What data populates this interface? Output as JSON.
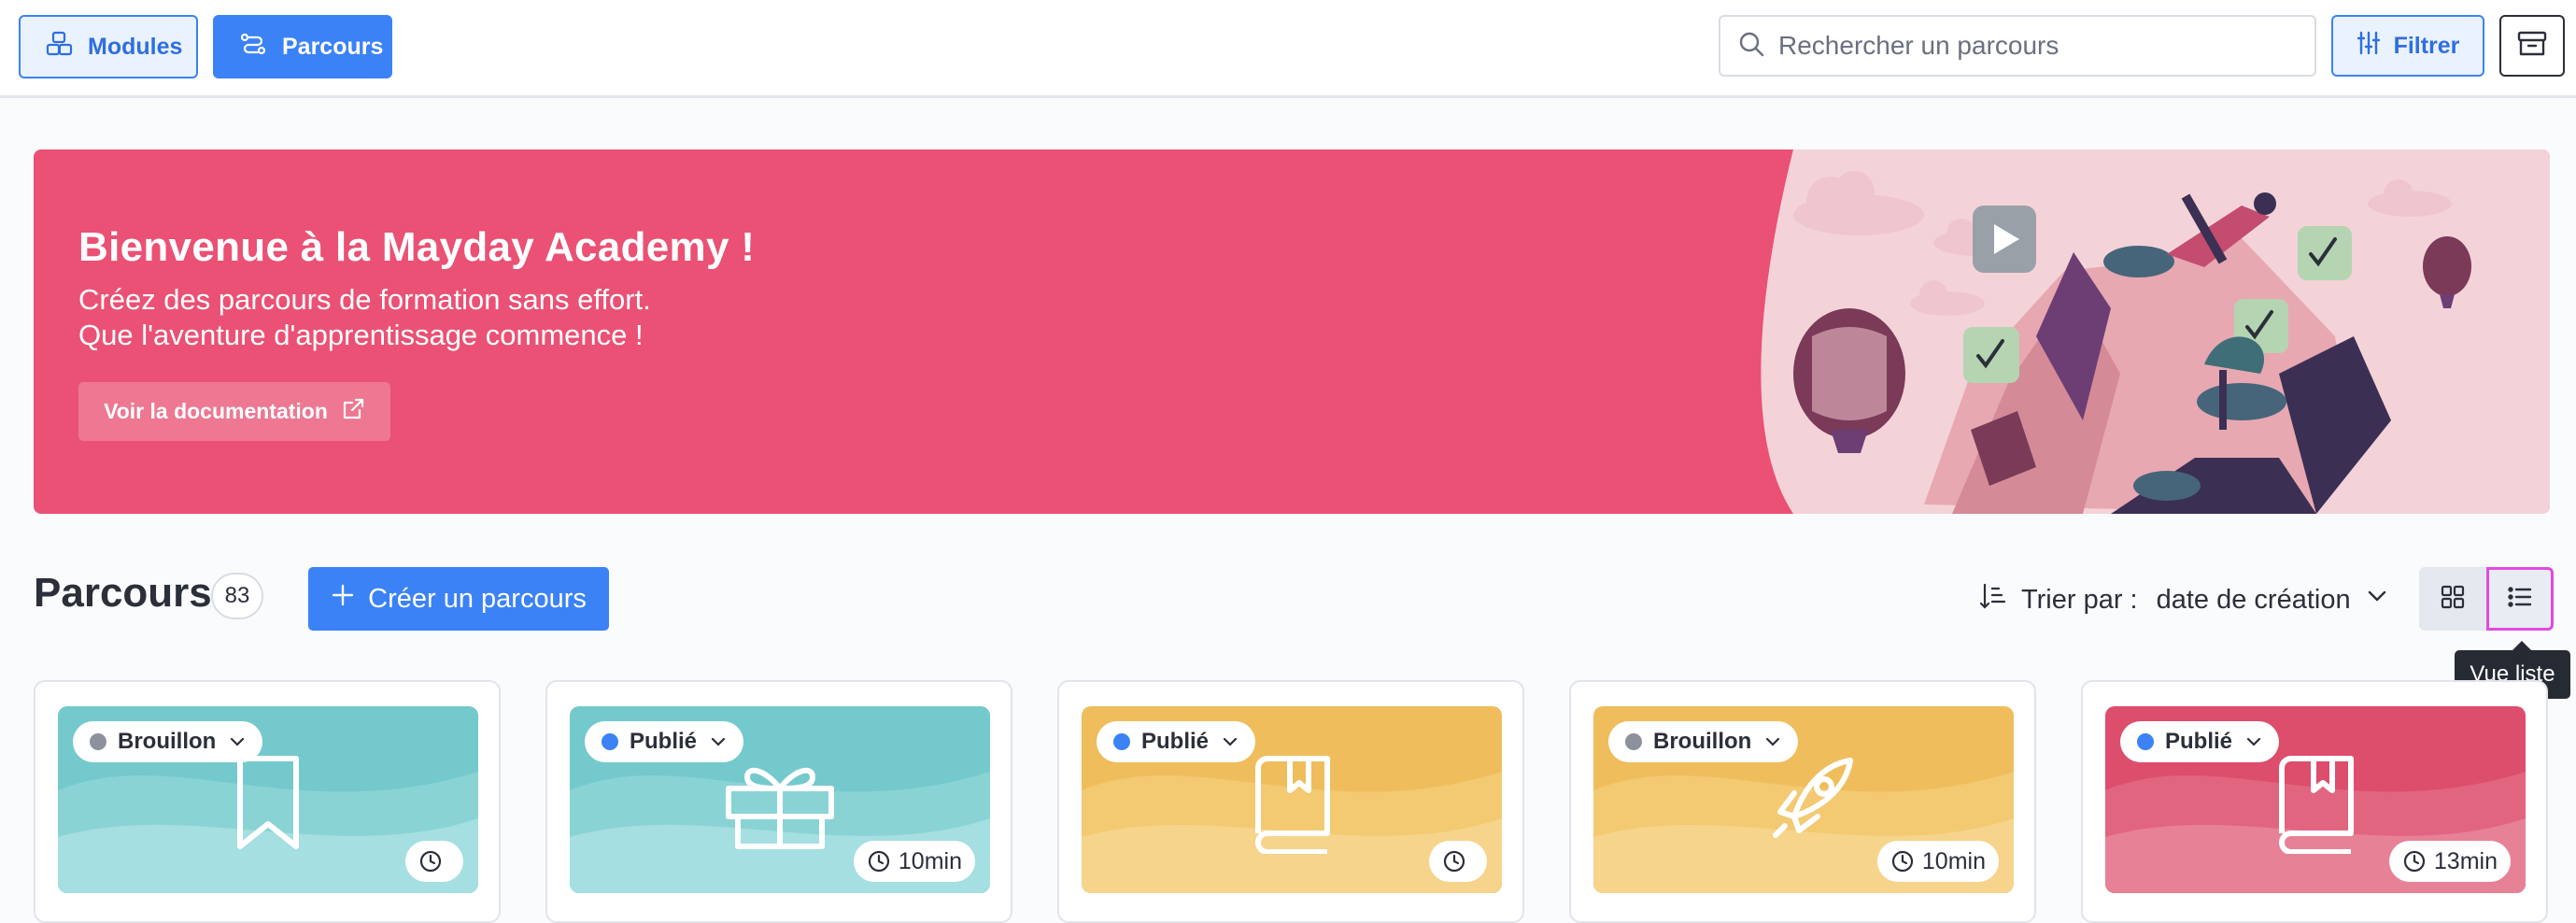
{
  "topbar": {
    "modules_label": "Modules",
    "parcours_label": "Parcours",
    "search_placeholder": "Rechercher un parcours",
    "filter_label": "Filtrer"
  },
  "banner": {
    "title": "Bienvenue à la Mayday Academy !",
    "subtitle_line1": "Créez des parcours de formation sans effort.",
    "subtitle_line2": "Que l'aventure d'apprentissage commence !",
    "doc_button": "Voir la documentation"
  },
  "section": {
    "title": "Parcours",
    "count": "83",
    "create_button": "Créer un parcours",
    "sort_label": "Trier par :",
    "sort_value": "date de création",
    "tooltip": "Vue liste"
  },
  "cards": [
    {
      "status": "Brouillon",
      "duration": "",
      "theme": "teal",
      "icon": "bookmark-icon"
    },
    {
      "status": "Publié",
      "duration": "10min",
      "theme": "teal",
      "icon": "gift-icon"
    },
    {
      "status": "Publié",
      "duration": "",
      "theme": "yellow",
      "icon": "book-icon"
    },
    {
      "status": "Brouillon",
      "duration": "10min",
      "theme": "yellow",
      "icon": "rocket-icon"
    },
    {
      "status": "Publié",
      "duration": "13min",
      "theme": "red",
      "icon": "book-icon"
    }
  ],
  "colors": {
    "primary": "#3b82f6",
    "banner": "#ea5174",
    "draft_dot": "#8c919c",
    "published_dot": "#3b82f6",
    "teal": "#74c9cc",
    "yellow": "#f0bd5c",
    "red": "#dd4d6c"
  }
}
